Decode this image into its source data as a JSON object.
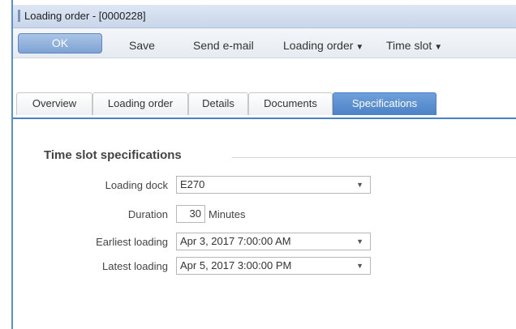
{
  "window": {
    "title": "Loading order - [0000228]"
  },
  "toolbar": {
    "ok_label": "OK",
    "save_label": "Save",
    "send_email_label": "Send e-mail",
    "loading_order_label": "Loading order",
    "time_slot_label": "Time slot"
  },
  "tabs": [
    {
      "label": "Overview"
    },
    {
      "label": "Loading order"
    },
    {
      "label": "Details"
    },
    {
      "label": "Documents"
    },
    {
      "label": "Specifications",
      "active": true
    }
  ],
  "section": {
    "title": "Time slot specifications"
  },
  "form": {
    "loading_dock": {
      "label": "Loading dock",
      "value": "E270"
    },
    "duration": {
      "label": "Duration",
      "value": "30",
      "unit": "Minutes"
    },
    "earliest_loading": {
      "label": "Earliest loading",
      "value": "Apr 3, 2017 7:00:00 AM"
    },
    "latest_loading": {
      "label": "Latest loading",
      "value": "Apr 5, 2017 3:00:00 PM"
    }
  },
  "colors": {
    "accent": "#4b81c6",
    "ok_button": "#7ea3d3",
    "titlebar": "#c9d6ea"
  },
  "icons": {
    "dropdown": "triangle-down-icon"
  }
}
